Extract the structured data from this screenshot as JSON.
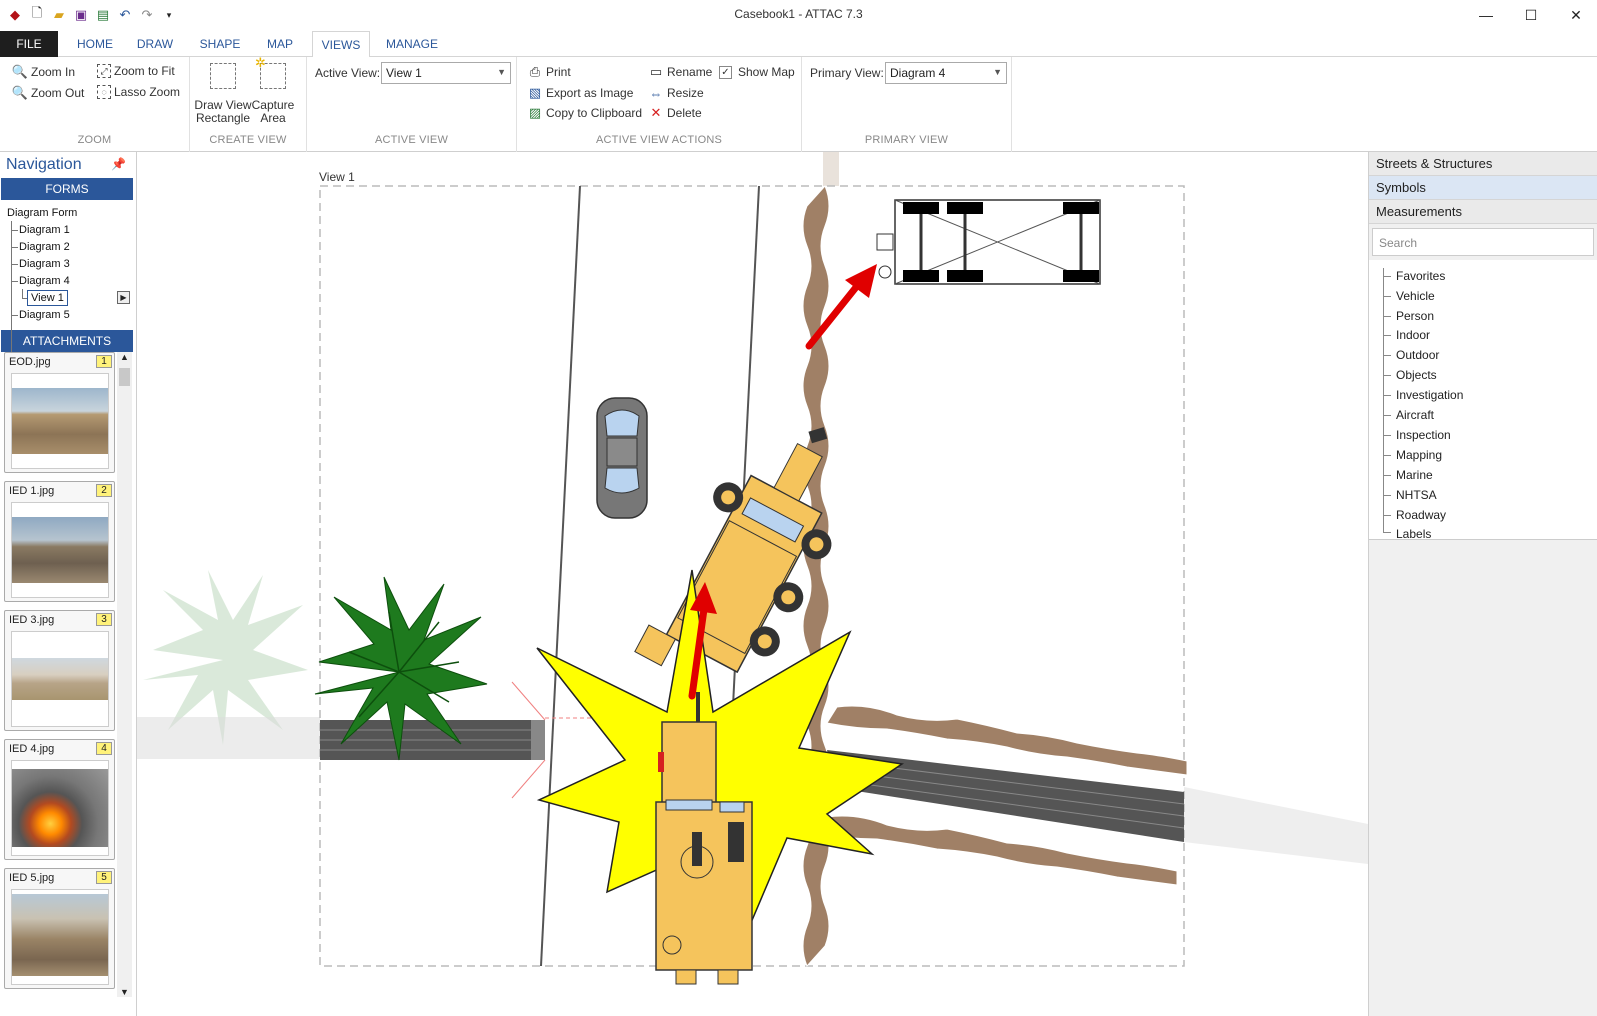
{
  "window": {
    "title": "Casebook1 - ATTAC 7.3",
    "minimize": "—",
    "maximize": "☐",
    "close": "✕"
  },
  "tabs": [
    {
      "label": "FILE"
    },
    {
      "label": "HOME"
    },
    {
      "label": "DRAW"
    },
    {
      "label": "SHAPE"
    },
    {
      "label": "MAP"
    },
    {
      "label": "VIEWS"
    },
    {
      "label": "MANAGE"
    }
  ],
  "ribbon": {
    "zoom": {
      "zoom_in": "Zoom In",
      "zoom_out": "Zoom Out",
      "zoom_to_fit": "Zoom to Fit",
      "lasso_zoom": "Lasso Zoom",
      "label": "ZOOM"
    },
    "create_view": {
      "draw_view_rectangle": "Draw View Rectangle",
      "capture_area": "Capture Area",
      "label": "CREATE VIEW"
    },
    "active_view": {
      "field_label": "Active View:",
      "value": "View 1",
      "label": "ACTIVE VIEW"
    },
    "active_view_actions": {
      "print": "Print",
      "export_as_image": "Export as Image",
      "copy_to_clipboard": "Copy to Clipboard",
      "rename": "Rename",
      "resize": "Resize",
      "delete": "Delete",
      "show_map": "Show Map",
      "show_map_checked": true,
      "label": "ACTIVE VIEW ACTIONS"
    },
    "primary_view": {
      "field_label": "Primary View:",
      "value": "Diagram 4",
      "label": "PRIMARY VIEW"
    }
  },
  "navigation": {
    "title": "Navigation",
    "forms_label": "FORMS",
    "tree": {
      "root": "Diagram Form",
      "items": [
        "Diagram 1",
        "Diagram 2",
        "Diagram 3",
        "Diagram 4",
        "View 1",
        "Diagram 5"
      ],
      "selected": "View 1"
    },
    "attachments_label": "ATTACHMENTS",
    "attachments": [
      {
        "name": "EOD.jpg",
        "num": "1"
      },
      {
        "name": "IED 1.jpg",
        "num": "2"
      },
      {
        "name": "IED 3.jpg",
        "num": "3"
      },
      {
        "name": "IED 4.jpg",
        "num": "4"
      },
      {
        "name": "IED 5.jpg",
        "num": "5"
      }
    ]
  },
  "canvas": {
    "view_label": "View 1"
  },
  "right_pane": {
    "tabs": [
      "Streets & Structures",
      "Symbols",
      "Measurements"
    ],
    "selected_tab": "Symbols",
    "search_placeholder": "Search",
    "categories": [
      "Favorites",
      "Vehicle",
      "Person",
      "Indoor",
      "Outdoor",
      "Objects",
      "Investigation",
      "Aircraft",
      "Inspection",
      "Mapping",
      "Marine",
      "NHTSA",
      "Roadway",
      "Labels"
    ]
  },
  "colors": {
    "accent": "#2b579a",
    "explosion": "#ffff00",
    "vehicle": "#f5c45c",
    "arrow": "#e00000",
    "palm": "#1e7a1e"
  }
}
